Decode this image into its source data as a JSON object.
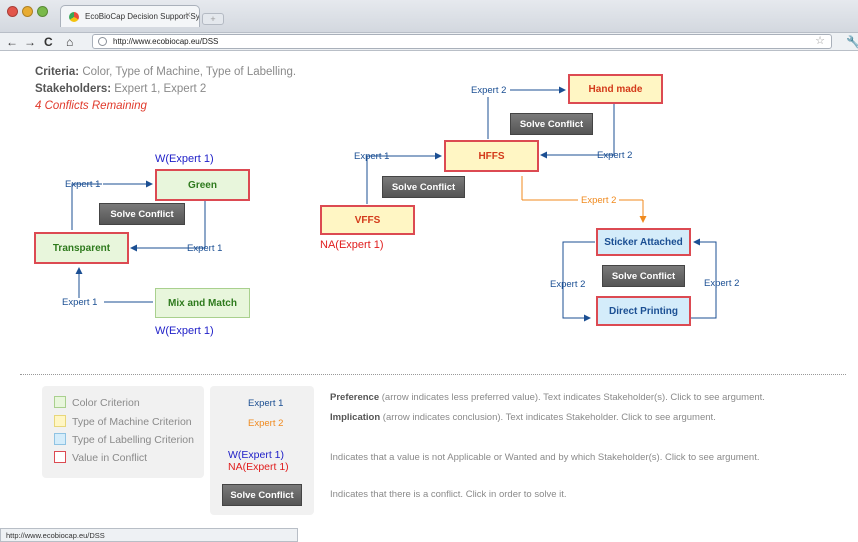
{
  "browser": {
    "tab_title": "EcoBioCap Decision Support Sys",
    "url": "http://www.ecobiocap.eu/DSS",
    "status_url": "http://www.ecobiocap.eu/DSS"
  },
  "header": {
    "criteria_label": "Criteria:",
    "criteria_value": "Color, Type of Machine, Type of Labelling.",
    "stakeholders_label": "Stakeholders:",
    "stakeholders_value": "Expert 1, Expert 2",
    "conflicts": "4 Conflicts Remaining"
  },
  "color_graph": {
    "green": "Green",
    "transparent": "Transparent",
    "mix": "Mix and Match",
    "w_top": "W(Expert 1)",
    "w_bottom": "W(Expert 1)",
    "solve": "Solve Conflict",
    "edges": [
      "Expert 1",
      "Expert 1",
      "Expert 1"
    ]
  },
  "machine_graph": {
    "hand_made": "Hand made",
    "hffs": "HFFS",
    "vffs": "VFFS",
    "na": "NA(Expert 1)",
    "solve_top": "Solve Conflict",
    "solve_mid": "Solve Conflict",
    "edge_expert2_top": "Expert 2",
    "edge_expert1": "Expert 1",
    "edge_expert2_right": "Expert 2",
    "implication": "Expert 2"
  },
  "label_graph": {
    "sticker": "Sticker Attached",
    "direct": "Direct Printing",
    "solve": "Solve Conflict",
    "edge_left": "Expert 2",
    "edge_right": "Expert 2"
  },
  "legend": {
    "items": [
      {
        "label": "Color Criterion",
        "color": "#e8f6dc",
        "border": "#a9d08e"
      },
      {
        "label": "Type of Machine Criterion",
        "color": "#fff6c4",
        "border": "#e8d77a"
      },
      {
        "label": "Type of Labelling Criterion",
        "color": "#d4ecfa",
        "border": "#8fc3e3"
      },
      {
        "label": "Value in Conflict",
        "color": "#ffffff",
        "border": "#dc4a52"
      }
    ]
  },
  "key": {
    "pref_label": "Expert 1",
    "impl_label": "Expert 2",
    "w_sample": "W(Expert 1)",
    "na_sample": "NA(Expert 1)",
    "solve": "Solve Conflict",
    "pref_title": "Preference",
    "pref_text": "(arrow indicates less preferred value). Text indicates Stakeholder(s). Click to see argument.",
    "impl_title": "Implication",
    "impl_text": "(arrow indicates conclusion). Text indicates Stakeholder. Click to see argument.",
    "na_text": "Indicates that a value is not Applicable or Wanted and by which Stakeholder(s). Click to see argument.",
    "solve_text": "Indicates that there is a conflict. Click in order to solve it."
  }
}
